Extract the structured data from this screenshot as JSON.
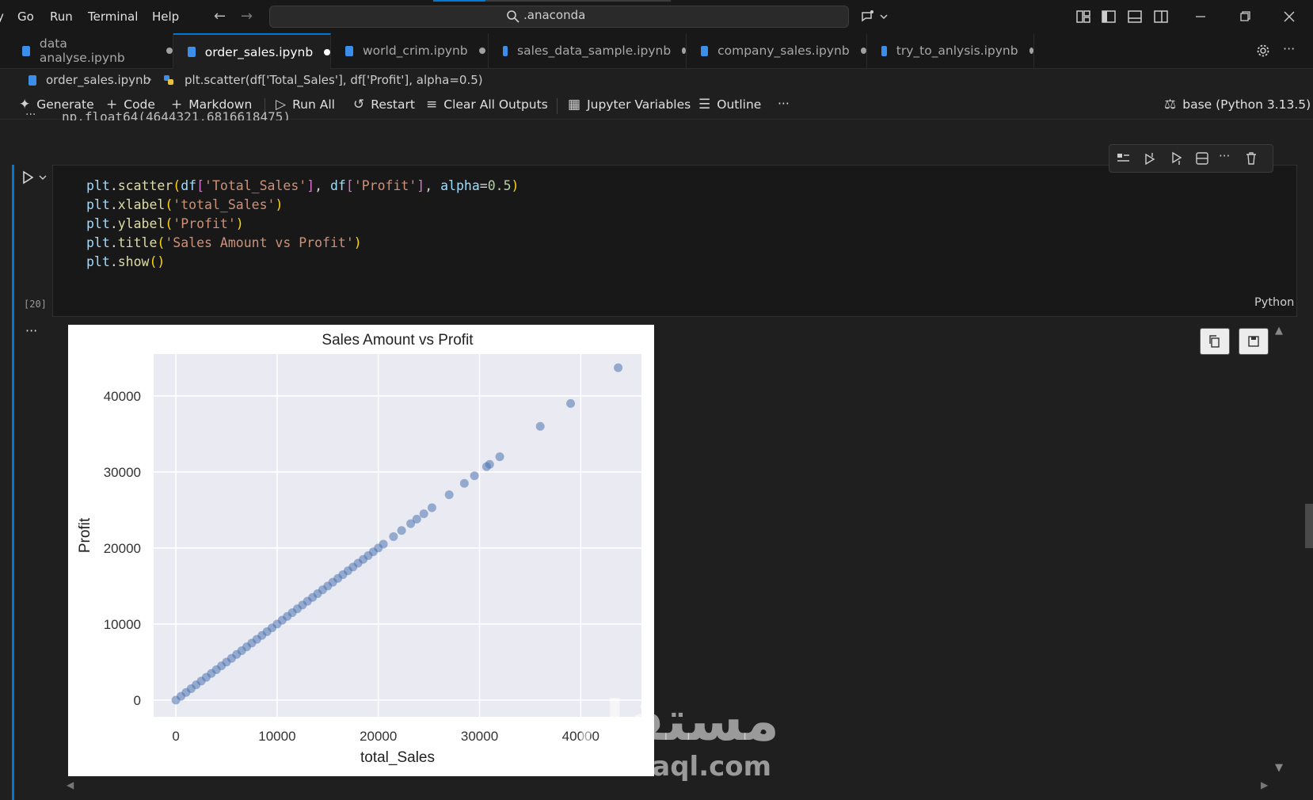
{
  "menu": {
    "items": [
      "y",
      "Go",
      "Run",
      "Terminal",
      "Help"
    ]
  },
  "search": {
    "text": ".anaconda"
  },
  "progress": {
    "fraction": 0.22
  },
  "tabs": [
    {
      "label": "data analyse.ipynb",
      "active": false
    },
    {
      "label": "order_sales.ipynb",
      "active": true
    },
    {
      "label": "world_crim.ipynb",
      "active": false
    },
    {
      "label": "sales_data_sample.ipynb",
      "active": false
    },
    {
      "label": "company_sales.ipynb",
      "active": false
    },
    {
      "label": "try_to_anlysis.ipynb",
      "active": false
    }
  ],
  "breadcrumb": {
    "file": "order_sales.ipynb",
    "symbol": "plt.scatter(df['Total_Sales'], df['Profit'], alpha=0.5)"
  },
  "toolbar": {
    "generate": "Generate",
    "code": "Code",
    "markdown": "Markdown",
    "run_all": "Run All",
    "restart": "Restart",
    "clear_outputs": "Clear All Outputs",
    "variables": "Jupyter Variables",
    "outline": "Outline",
    "more": "···",
    "kernel": "base (Python 3.13.5)"
  },
  "prev_output": "np.float64(4644321.6816618475)",
  "cell": {
    "execution_count": "[20]",
    "language": "Python",
    "code": [
      "plt.scatter(df['Total_Sales'], df['Profit'], alpha=0.5)",
      "plt.xlabel('total_Sales')",
      "plt.ylabel('Profit')",
      "plt.title('Sales Amount vs Profit')",
      "plt.show()"
    ]
  },
  "watermark": {
    "arabic": "مستقل",
    "latin": "mostaql.com"
  },
  "colors": {
    "accent": "#0078d4",
    "point": "#4c72b0",
    "plot_bg": "#eaeaf2"
  },
  "chart_data": {
    "type": "scatter",
    "title": "Sales Amount vs Profit",
    "xlabel": "total_Sales",
    "ylabel": "Profit",
    "xlim": [
      -2200,
      46000
    ],
    "ylim": [
      -2200,
      45500
    ],
    "xticks": [
      0,
      10000,
      20000,
      30000,
      40000
    ],
    "yticks": [
      0,
      10000,
      20000,
      30000,
      40000
    ],
    "xtick_labels": [
      "0",
      "10000",
      "20000",
      "30000",
      "40000"
    ],
    "ytick_labels": [
      "0",
      "10000",
      "20000",
      "30000",
      "40000"
    ],
    "grid": true,
    "series": [
      {
        "points": [
          [
            0,
            0
          ],
          [
            500,
            500
          ],
          [
            1000,
            1000
          ],
          [
            1500,
            1500
          ],
          [
            2000,
            2000
          ],
          [
            2500,
            2500
          ],
          [
            3000,
            3000
          ],
          [
            3500,
            3500
          ],
          [
            4000,
            4000
          ],
          [
            4500,
            4500
          ],
          [
            5000,
            5000
          ],
          [
            5500,
            5500
          ],
          [
            6000,
            6000
          ],
          [
            6500,
            6500
          ],
          [
            7000,
            7000
          ],
          [
            7500,
            7500
          ],
          [
            8000,
            8000
          ],
          [
            8500,
            8500
          ],
          [
            9000,
            9000
          ],
          [
            9500,
            9500
          ],
          [
            10000,
            10000
          ],
          [
            10500,
            10500
          ],
          [
            11000,
            11000
          ],
          [
            11500,
            11500
          ],
          [
            12000,
            12000
          ],
          [
            12500,
            12500
          ],
          [
            13000,
            13000
          ],
          [
            13500,
            13500
          ],
          [
            14000,
            14000
          ],
          [
            14500,
            14500
          ],
          [
            15000,
            15000
          ],
          [
            15500,
            15500
          ],
          [
            16000,
            16000
          ],
          [
            16500,
            16500
          ],
          [
            17000,
            17000
          ],
          [
            17500,
            17500
          ],
          [
            18000,
            18000
          ],
          [
            18500,
            18500
          ],
          [
            19000,
            19000
          ],
          [
            19500,
            19500
          ],
          [
            20000,
            20000
          ],
          [
            20500,
            20500
          ],
          [
            21500,
            21500
          ],
          [
            22300,
            22300
          ],
          [
            23200,
            23200
          ],
          [
            23800,
            23800
          ],
          [
            24500,
            24500
          ],
          [
            25300,
            25300
          ],
          [
            27000,
            27000
          ],
          [
            28500,
            28500
          ],
          [
            29500,
            29500
          ],
          [
            30700,
            30700
          ],
          [
            31000,
            31000
          ],
          [
            32000,
            32000
          ],
          [
            36000,
            36000
          ],
          [
            39000,
            39000
          ],
          [
            43700,
            43700
          ]
        ]
      }
    ]
  }
}
